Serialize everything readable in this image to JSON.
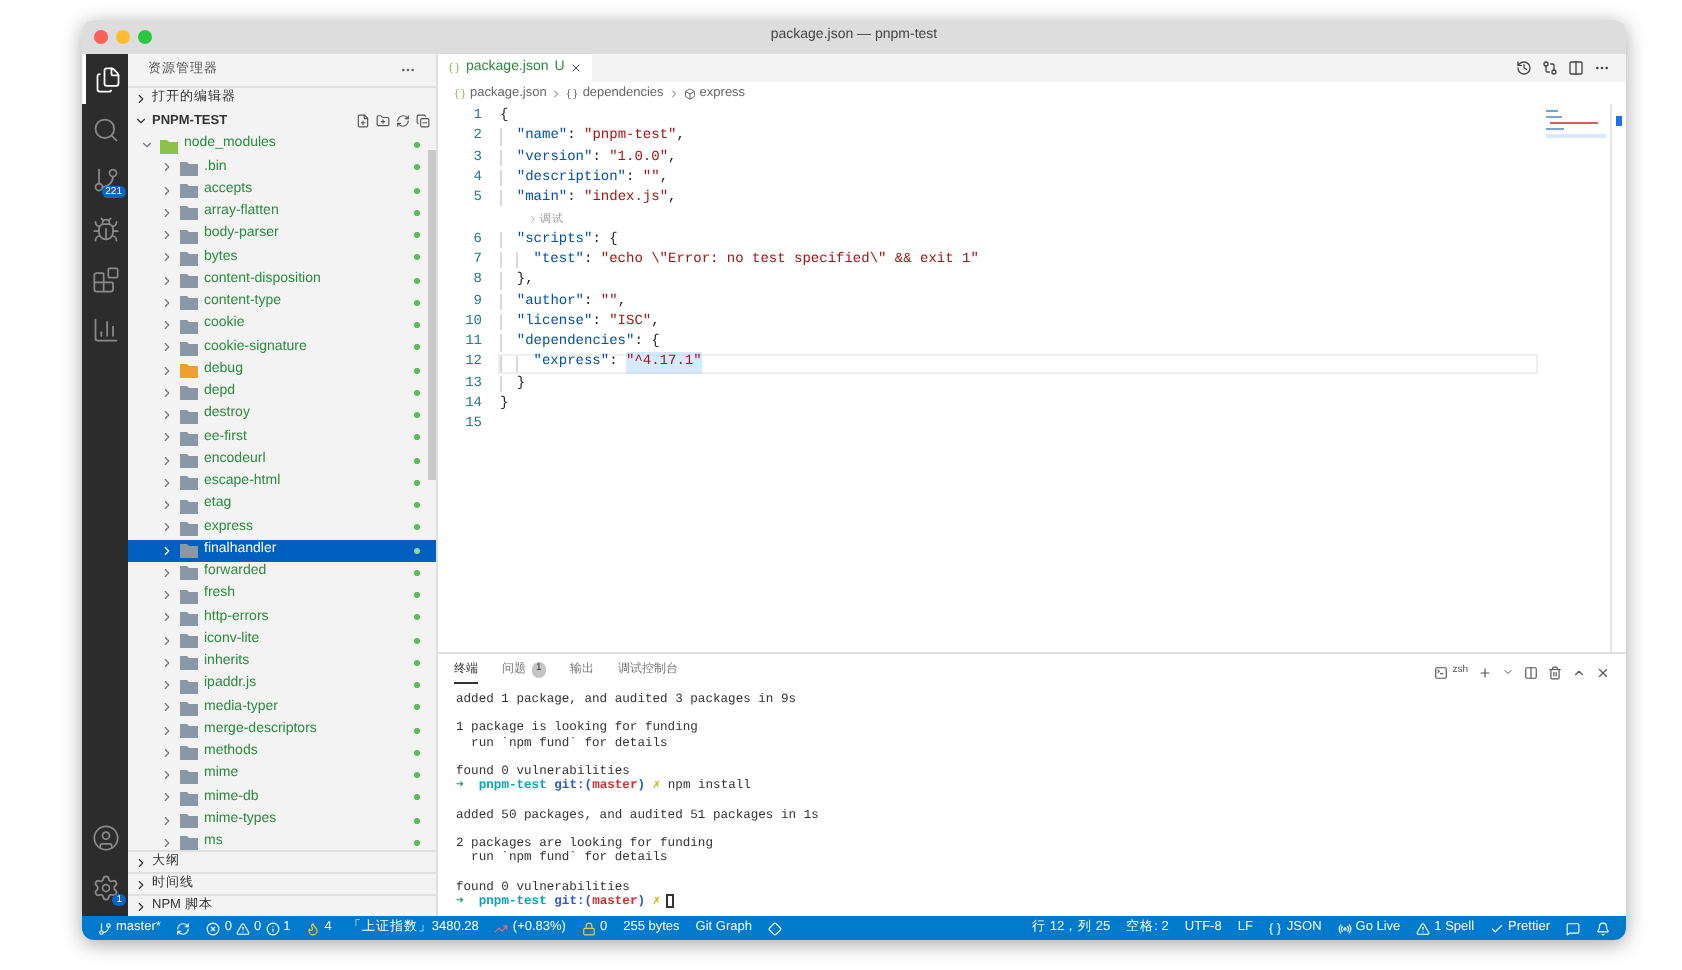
{
  "window": {
    "title": "package.json — pnpm-test"
  },
  "activity_bar": {
    "items": [
      {
        "kind": "files",
        "selected": true
      },
      {
        "kind": "search",
        "selected": false
      },
      {
        "kind": "source-control",
        "selected": false,
        "badge": "221"
      },
      {
        "kind": "run",
        "selected": false
      },
      {
        "kind": "extensions",
        "selected": false
      },
      {
        "kind": "chart",
        "selected": false
      }
    ],
    "bottom": [
      {
        "kind": "account"
      },
      {
        "kind": "settings",
        "badge": "1"
      }
    ]
  },
  "sidebar": {
    "title": "资源管理器",
    "top_sections": [
      {
        "title": "打开的编辑器",
        "expanded": false
      }
    ],
    "project": {
      "title": "PNPM-TEST",
      "expanded": true,
      "tree": [
        {
          "label": "node_modules",
          "expanded": true,
          "selected": false,
          "children": [
            {
              "label": ".bin",
              "expanded": false,
              "selected": false,
              "color": "#8a98a5"
            },
            {
              "label": "accepts",
              "expanded": false,
              "selected": false,
              "color": "#8a98a5"
            },
            {
              "label": "array-flatten",
              "expanded": false,
              "selected": false,
              "color": "#8a98a5"
            },
            {
              "label": "body-parser",
              "expanded": false,
              "selected": false,
              "color": "#8a98a5"
            },
            {
              "label": "bytes",
              "expanded": false,
              "selected": false,
              "color": "#8a98a5"
            },
            {
              "label": "content-disposition",
              "expanded": false,
              "selected": false,
              "color": "#8a98a5"
            },
            {
              "label": "content-type",
              "expanded": false,
              "selected": false,
              "color": "#8a98a5"
            },
            {
              "label": "cookie",
              "expanded": false,
              "selected": false,
              "color": "#8a98a5"
            },
            {
              "label": "cookie-signature",
              "expanded": false,
              "selected": false,
              "color": "#8a98a5"
            },
            {
              "label": "debug",
              "expanded": false,
              "selected": false,
              "color": "#f0a030"
            },
            {
              "label": "depd",
              "expanded": false,
              "selected": false,
              "color": "#8a98a5"
            },
            {
              "label": "destroy",
              "expanded": false,
              "selected": false,
              "color": "#8a98a5"
            },
            {
              "label": "ee-first",
              "expanded": false,
              "selected": false,
              "color": "#8a98a5"
            },
            {
              "label": "encodeurl",
              "expanded": false,
              "selected": false,
              "color": "#8a98a5"
            },
            {
              "label": "escape-html",
              "expanded": false,
              "selected": false,
              "color": "#8a98a5"
            },
            {
              "label": "etag",
              "expanded": false,
              "selected": false,
              "color": "#8a98a5"
            },
            {
              "label": "express",
              "expanded": false,
              "selected": false,
              "color": "#8a98a5"
            },
            {
              "label": "finalhandler",
              "expanded": false,
              "selected": true,
              "color": "#8a98a5"
            },
            {
              "label": "forwarded",
              "expanded": false,
              "selected": false,
              "color": "#8a98a5"
            },
            {
              "label": "fresh",
              "expanded": false,
              "selected": false,
              "color": "#8a98a5"
            },
            {
              "label": "http-errors",
              "expanded": false,
              "selected": false,
              "color": "#8a98a5"
            },
            {
              "label": "iconv-lite",
              "expanded": false,
              "selected": false,
              "color": "#8a98a5"
            },
            {
              "label": "inherits",
              "expanded": false,
              "selected": false,
              "color": "#8a98a5"
            },
            {
              "label": "ipaddr.js",
              "expanded": false,
              "selected": false,
              "color": "#8a98a5"
            },
            {
              "label": "media-typer",
              "expanded": false,
              "selected": false,
              "color": "#8a98a5"
            },
            {
              "label": "merge-descriptors",
              "expanded": false,
              "selected": false,
              "color": "#8a98a5"
            },
            {
              "label": "methods",
              "expanded": false,
              "selected": false,
              "color": "#8a98a5"
            },
            {
              "label": "mime",
              "expanded": false,
              "selected": false,
              "color": "#8a98a5"
            },
            {
              "label": "mime-db",
              "expanded": false,
              "selected": false,
              "color": "#8a98a5"
            },
            {
              "label": "mime-types",
              "expanded": false,
              "selected": false,
              "color": "#8a98a5"
            },
            {
              "label": "ms",
              "expanded": false,
              "selected": false,
              "color": "#8a98a5"
            }
          ]
        }
      ]
    },
    "bottom_sections": [
      {
        "title": "大纲",
        "expanded": false
      },
      {
        "title": "时间线",
        "expanded": false
      },
      {
        "title": "NPM 脚本",
        "expanded": false
      }
    ]
  },
  "editor": {
    "tabs": [
      {
        "label": "package.json",
        "status": "U",
        "selected": true
      }
    ],
    "breadcrumb": [
      {
        "kind": "file",
        "text": "package.json"
      },
      {
        "kind": "object",
        "text": "dependencies"
      },
      {
        "kind": "property",
        "text": "express"
      }
    ],
    "lines": [
      {
        "kind": "code",
        "number": "1",
        "current": false,
        "tokens": [
          {
            "kind": "punct",
            "text": "{"
          }
        ]
      },
      {
        "kind": "code",
        "number": "2",
        "current": false,
        "in_object": true,
        "tokens": [
          {
            "kind": "key",
            "text": "\"name\""
          },
          {
            "kind": "punct",
            "text": ": "
          },
          {
            "kind": "string",
            "text": "\"pnpm-test\""
          },
          {
            "kind": "punct",
            "text": ","
          }
        ]
      },
      {
        "kind": "code",
        "number": "3",
        "current": false,
        "in_object": true,
        "tokens": [
          {
            "kind": "key",
            "text": "\"version\""
          },
          {
            "kind": "punct",
            "text": ": "
          },
          {
            "kind": "string",
            "text": "\"1.0.0\""
          },
          {
            "kind": "punct",
            "text": ","
          }
        ]
      },
      {
        "kind": "code",
        "number": "4",
        "current": false,
        "in_object": true,
        "tokens": [
          {
            "kind": "key",
            "text": "\"description\""
          },
          {
            "kind": "punct",
            "text": ": "
          },
          {
            "kind": "string",
            "text": "\"\""
          },
          {
            "kind": "punct",
            "text": ","
          }
        ]
      },
      {
        "kind": "code",
        "number": "5",
        "current": false,
        "in_object": true,
        "tokens": [
          {
            "kind": "key",
            "text": "\"main\""
          },
          {
            "kind": "punct",
            "text": ": "
          },
          {
            "kind": "string",
            "text": "\"index.js\""
          },
          {
            "kind": "punct",
            "text": ","
          }
        ]
      },
      {
        "kind": "codelens",
        "text": "调试"
      },
      {
        "kind": "code",
        "number": "6",
        "current": false,
        "in_object": true,
        "tokens": [
          {
            "kind": "key",
            "text": "\"scripts\""
          },
          {
            "kind": "punct",
            "text": ": {"
          }
        ]
      },
      {
        "kind": "code",
        "number": "7",
        "current": false,
        "in_object": true,
        "in_nested": true,
        "tokens": [
          {
            "kind": "key",
            "text": "\"test\""
          },
          {
            "kind": "punct",
            "text": ": "
          },
          {
            "kind": "string",
            "text": "\"echo \\\"Error: no test specified\\\" && exit 1\""
          }
        ]
      },
      {
        "kind": "code",
        "number": "8",
        "current": false,
        "in_object": true,
        "tokens": [
          {
            "kind": "punct",
            "text": "},"
          }
        ]
      },
      {
        "kind": "code",
        "number": "9",
        "current": false,
        "in_object": true,
        "tokens": [
          {
            "kind": "key",
            "text": "\"author\""
          },
          {
            "kind": "punct",
            "text": ": "
          },
          {
            "kind": "string",
            "text": "\"\""
          },
          {
            "kind": "punct",
            "text": ","
          }
        ]
      },
      {
        "kind": "code",
        "number": "10",
        "current": false,
        "in_object": true,
        "tokens": [
          {
            "kind": "key",
            "text": "\"license\""
          },
          {
            "kind": "punct",
            "text": ": "
          },
          {
            "kind": "string",
            "text": "\"ISC\""
          },
          {
            "kind": "punct",
            "text": ","
          }
        ]
      },
      {
        "kind": "code",
        "number": "11",
        "current": false,
        "in_object": true,
        "tokens": [
          {
            "kind": "key",
            "text": "\"dependencies\""
          },
          {
            "kind": "punct",
            "text": ": {"
          }
        ]
      },
      {
        "kind": "code",
        "number": "12",
        "current": true,
        "in_object": true,
        "in_nested": true,
        "tokens": [
          {
            "kind": "key",
            "text": "\"express\""
          },
          {
            "kind": "punct",
            "text": ": "
          },
          {
            "kind": "string",
            "text": "\"^4.17.1\"",
            "highlighted": true
          }
        ]
      },
      {
        "kind": "code",
        "number": "13",
        "current": false,
        "in_object": true,
        "tokens": [
          {
            "kind": "punct",
            "text": "}"
          }
        ]
      },
      {
        "kind": "code",
        "number": "14",
        "current": false,
        "tokens": [
          {
            "kind": "punct",
            "text": "}"
          }
        ]
      },
      {
        "kind": "code",
        "number": "15",
        "current": false
      }
    ]
  },
  "panel": {
    "tabs": [
      {
        "label": "终端",
        "selected": true
      },
      {
        "label": "问题",
        "badge": "1",
        "selected": false
      },
      {
        "label": "输出",
        "selected": false
      },
      {
        "label": "调试控制台",
        "selected": false
      }
    ],
    "shell": "zsh",
    "terminal": [
      [
        {
          "kind": "text",
          "text": "added 1 package, and audited 3 packages in 9s"
        }
      ],
      [
        {
          "kind": "text",
          "text": "1 package is looking for funding"
        },
        {
          "kind": "text",
          "text": "  run `npm fund` for details"
        }
      ],
      [
        {
          "kind": "text",
          "text": "found 0 vulnerabilities"
        },
        {
          "kind": "prompt",
          "arrow": "➜",
          "dir": "pnpm-test",
          "git_open": "git:(",
          "branch": "master",
          "git_close": ")",
          "mark": "✗",
          "command": "npm install"
        }
      ],
      [
        {
          "kind": "text",
          "text": "added 50 packages, and audited 51 packages in 1s"
        }
      ],
      [
        {
          "kind": "text",
          "text": "2 packages are looking for funding"
        },
        {
          "kind": "text",
          "text": "  run `npm fund` for details"
        }
      ],
      [
        {
          "kind": "text",
          "text": "found 0 vulnerabilities"
        },
        {
          "kind": "prompt",
          "arrow": "➜",
          "dir": "pnpm-test",
          "git_open": "git:(",
          "branch": "master",
          "git_close": ")",
          "mark": "✗",
          "cursor": true
        }
      ]
    ]
  },
  "status_bar": {
    "left": [
      {
        "kind": "branch",
        "text": "master*"
      },
      {
        "kind": "sync"
      },
      {
        "kind": "problems",
        "errors": "0",
        "warnings": "0",
        "infos": "1"
      },
      {
        "kind": "flame",
        "text": "4"
      },
      {
        "kind": "text",
        "text": "「上证指数」3480.28"
      },
      {
        "kind": "change",
        "text": "(+0.83%)"
      },
      {
        "kind": "lock",
        "text": "0"
      },
      {
        "kind": "text",
        "text": "255 bytes"
      },
      {
        "kind": "text",
        "text": "Git Graph"
      },
      {
        "kind": "diamond"
      }
    ],
    "right": [
      {
        "kind": "text",
        "text": "行 12，列 25"
      },
      {
        "kind": "text",
        "text": "空格: 2"
      },
      {
        "kind": "text",
        "text": "UTF-8"
      },
      {
        "kind": "text",
        "text": "LF"
      },
      {
        "kind": "language",
        "text": "JSON"
      },
      {
        "kind": "live",
        "text": "Go Live"
      },
      {
        "kind": "warning",
        "text": "1 Spell"
      },
      {
        "kind": "check",
        "text": "Prettier"
      },
      {
        "kind": "feedback"
      },
      {
        "kind": "bell"
      }
    ]
  }
}
